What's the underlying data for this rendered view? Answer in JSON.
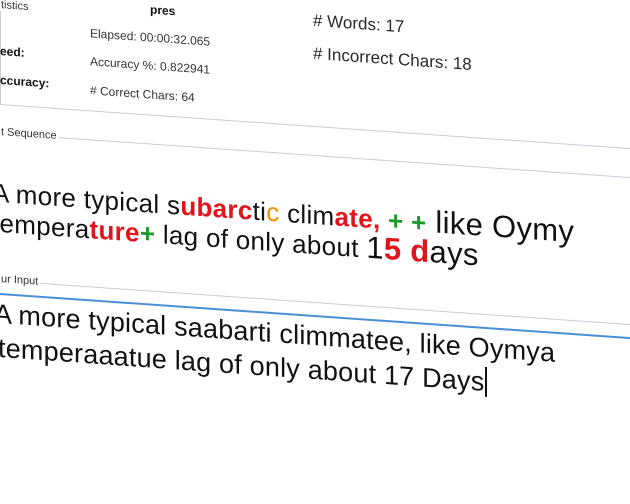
{
  "stats": {
    "group_title": "tistics",
    "top_fragment": "pres",
    "labels": {
      "speed": "eed:",
      "accuracy": "ccuracy:"
    },
    "elapsed": "Elapsed: 00:00:32.065",
    "accuracy_pct": "Accuracy %: 0.822941",
    "correct_chars": "# Correct Chars: 64",
    "words": "# Words: 17",
    "incorrect_chars": "# Incorrect Chars: 18"
  },
  "sequence": {
    "group_title": "t Sequence",
    "line1": {
      "a": "A more typical s",
      "b": "ubarc",
      "c": "t",
      "d": "i",
      "e": "c",
      "f": " clim",
      "g": "ate,",
      "h": " + +",
      "i": "  like Oymy"
    },
    "line2": {
      "a": " tempera",
      "b": "ture",
      "c": "+",
      "d": " lag of only about ",
      "e": "1",
      "f": "5",
      "g": " ",
      "h": "d",
      "i": "ays"
    }
  },
  "input": {
    "group_title": "ur Input",
    "line1": "A more typical saabarti climmatee, like Oymya",
    "line2": "temperaaatue lag of only about 17 Days"
  }
}
